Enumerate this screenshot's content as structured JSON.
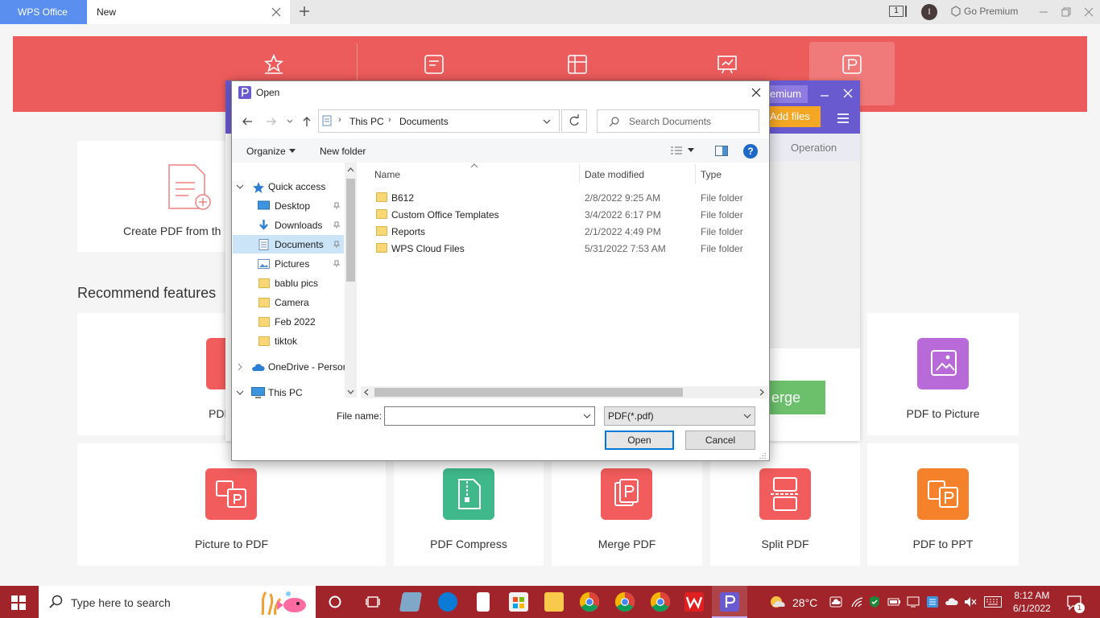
{
  "tabs": {
    "app": "WPS Office",
    "current": "New"
  },
  "titlebar": {
    "win_count": "1",
    "avatar": "I",
    "premium": "Go Premium"
  },
  "home": {
    "create_label": "Create PDF from th",
    "recommend_title": "Recommend features",
    "features_row1": [
      {
        "label": "PDF",
        "color": "#f25c5c"
      },
      {
        "label": "PDF to Picture",
        "color": "#b86ad8"
      }
    ],
    "features_row2": [
      {
        "label": "Picture to PDF",
        "color": "#f25c5c"
      },
      {
        "label": "PDF Compress",
        "color": "#3fb88c"
      },
      {
        "label": "Merge PDF",
        "color": "#f25c5c"
      },
      {
        "label": "Split PDF",
        "color": "#f25c5c"
      },
      {
        "label": "PDF to PPT",
        "color": "#f5822b"
      }
    ]
  },
  "pdf_panel": {
    "premium": "emium",
    "add_files": "Add files",
    "operation": "Operation",
    "merge": "erge"
  },
  "dialog": {
    "title": "Open",
    "breadcrumb": [
      "This PC",
      "Documents"
    ],
    "search_placeholder": "Search Documents",
    "organize": "Organize",
    "new_folder": "New folder",
    "tree": [
      {
        "label": "Quick access",
        "icon": "star-icon"
      },
      {
        "label": "Desktop",
        "icon": "desktop-icon"
      },
      {
        "label": "Downloads",
        "icon": "download-icon"
      },
      {
        "label": "Documents",
        "icon": "document-icon"
      },
      {
        "label": "Pictures",
        "icon": "pictures-icon"
      },
      {
        "label": "bablu pics",
        "icon": "folder-icon"
      },
      {
        "label": "Camera",
        "icon": "folder-icon"
      },
      {
        "label": "Feb 2022",
        "icon": "folder-icon"
      },
      {
        "label": "tiktok",
        "icon": "folder-icon"
      },
      {
        "label": "OneDrive - Persor",
        "icon": "cloud-icon"
      },
      {
        "label": "This PC",
        "icon": "computer-icon"
      }
    ],
    "columns": [
      "Name",
      "Date modified",
      "Type"
    ],
    "files": [
      {
        "name": "B612",
        "date": "2/8/2022 9:25 AM",
        "type": "File folder"
      },
      {
        "name": "Custom Office Templates",
        "date": "3/4/2022 6:17 PM",
        "type": "File folder"
      },
      {
        "name": "Reports",
        "date": "2/1/2022 4:49 PM",
        "type": "File folder"
      },
      {
        "name": "WPS Cloud Files",
        "date": "5/31/2022 7:53 AM",
        "type": "File folder"
      }
    ],
    "file_name_label": "File name:",
    "file_name_value": "",
    "file_type": "PDF(*.pdf)",
    "open": "Open",
    "cancel": "Cancel"
  },
  "taskbar": {
    "search_placeholder": "Type here to search",
    "temperature": "28°C",
    "time": "8:12 AM",
    "date": "6/1/2022",
    "notifications": "1"
  }
}
